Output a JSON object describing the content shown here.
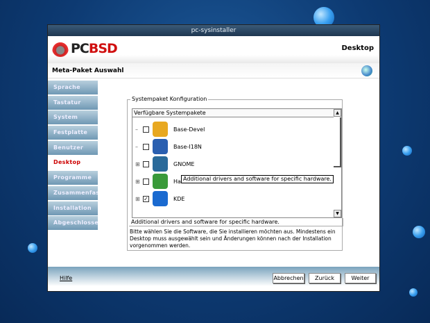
{
  "window": {
    "title": "pc-sysinstaller"
  },
  "header": {
    "logo": "PCBSD",
    "page_title": "Desktop",
    "subtitle": "Meta-Paket Auswahl"
  },
  "sidebar": {
    "items": [
      {
        "label": "Sprache"
      },
      {
        "label": "Tastatur"
      },
      {
        "label": "System"
      },
      {
        "label": "Festplatte"
      },
      {
        "label": "Benutzer"
      },
      {
        "label": "Desktop",
        "active": true
      },
      {
        "label": "Programme"
      },
      {
        "label": "Zusammenfas"
      },
      {
        "label": "Installation"
      },
      {
        "label": "Abgeschlosse"
      }
    ]
  },
  "group": {
    "label": "Systempaket Konfiguration",
    "list_header": "Verfügbare Systempakete",
    "packages": [
      {
        "label": "Base-Devel",
        "checked": false,
        "expandable": false,
        "color": "#e8a820"
      },
      {
        "label": "Base-I18N",
        "checked": false,
        "expandable": false,
        "color": "#2a5fb0"
      },
      {
        "label": "GNOME",
        "checked": false,
        "expandable": true,
        "color": "#2a6a9a"
      },
      {
        "label": "Hardware-Drivers",
        "checked": false,
        "expandable": true,
        "color": "#3a9a3a"
      },
      {
        "label": "KDE",
        "checked": true,
        "expandable": true,
        "color": "#1a6ad0"
      }
    ],
    "tooltip": "Additional drivers and software for specific hardware.",
    "description": "Additional drivers and software for specific hardware.",
    "help_text": "Bitte wählen Sie die Software, die Sie installieren möchten aus. Mindestens ein Desktop muss ausgewählt sein und Änderungen können nach der Installation vorgenommen werden."
  },
  "footer": {
    "help": "Hilfe",
    "cancel": "Abbrechen",
    "back": "Zurück",
    "next": "Weiter"
  }
}
